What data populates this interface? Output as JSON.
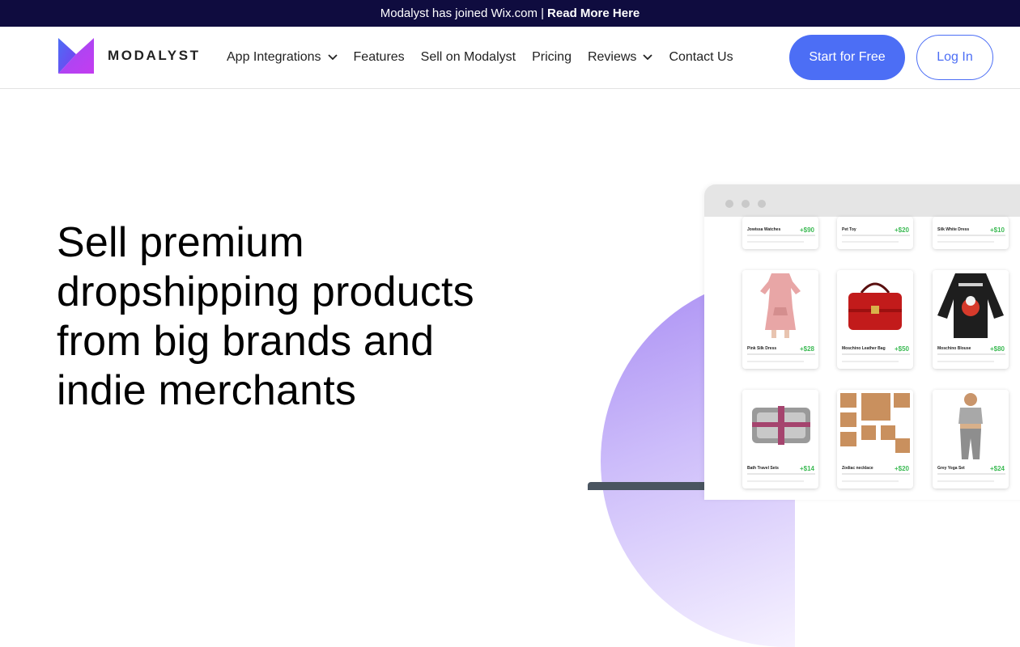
{
  "announcement": {
    "text": "Modalyst has joined Wix.com |",
    "link": "Read More Here"
  },
  "brand": {
    "name": "MODALYST"
  },
  "nav": {
    "items": [
      {
        "label": "App Integrations",
        "dropdown": true
      },
      {
        "label": "Features",
        "dropdown": false
      },
      {
        "label": "Sell on Modalyst",
        "dropdown": false
      },
      {
        "label": "Pricing",
        "dropdown": false
      },
      {
        "label": "Reviews",
        "dropdown": true
      },
      {
        "label": "Contact Us",
        "dropdown": false
      }
    ],
    "cta_label": "Start for Free",
    "login_label": "Log In"
  },
  "hero": {
    "headline": "Sell premium dropshipping products from big brands and indie merchants"
  },
  "products": [
    {
      "name": "Jowissa Watches",
      "price": "+$90"
    },
    {
      "name": "Pet Toy",
      "price": "+$20"
    },
    {
      "name": "Silk White Dress",
      "price": "+$10"
    },
    {
      "name": "Pink Silk Dress",
      "price": "+$28"
    },
    {
      "name": "Moschino Leather Bag",
      "price": "+$50"
    },
    {
      "name": "Moschino Blouse",
      "price": "+$80"
    },
    {
      "name": "Bath Travel Sets",
      "price": "+$14"
    },
    {
      "name": "Zodiac necklace",
      "price": "+$20"
    },
    {
      "name": "Grey Yoga Set",
      "price": "+$24"
    }
  ],
  "colors": {
    "accent": "#4c6ef5",
    "banner": "#0f0c3f",
    "price": "#3cba54"
  }
}
